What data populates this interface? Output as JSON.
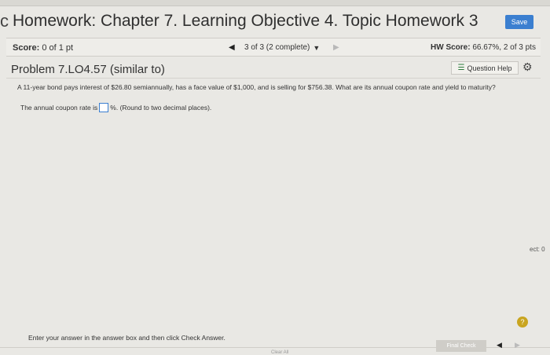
{
  "header": {
    "title_stub": "c",
    "title": "Homework: Chapter 7. Learning Objective 4. Topic Homework 3",
    "save_label": "Save"
  },
  "scorebar": {
    "score_label": "Score:",
    "score_value": "0 of 1 pt",
    "prev_icon": "◀",
    "question_selector": "3 of 3 (2 complete)",
    "selector_icon": "▼",
    "next_icon": "▶",
    "hw_score_label": "HW Score:",
    "hw_score_value": "66.67%, 2 of 3 pts"
  },
  "problem": {
    "title": "Problem 7.LO4.57 (similar to)",
    "help_label": "Question Help",
    "help_icon": "☰",
    "gear_icon": "⚙",
    "question": "A 11-year bond pays interest of $26.80 semiannually, has a face value of $1,000, and is selling for $756.38. What are its annual coupon rate and yield to maturity?",
    "answer_prefix": "The annual coupon rate is",
    "answer_suffix": "%.  (Round to two decimal places)."
  },
  "side": {
    "text": "ect: 0"
  },
  "footer": {
    "help_symbol": "?",
    "instructions": "Enter your answer in the answer box and then click Check Answer.",
    "clear_all": "Clear All",
    "final_check": "Final Check",
    "prev_icon": "◀",
    "next_icon": "▶"
  },
  "colors": {
    "accent": "#3b7fd0",
    "help_yellow": "#c9a520"
  }
}
